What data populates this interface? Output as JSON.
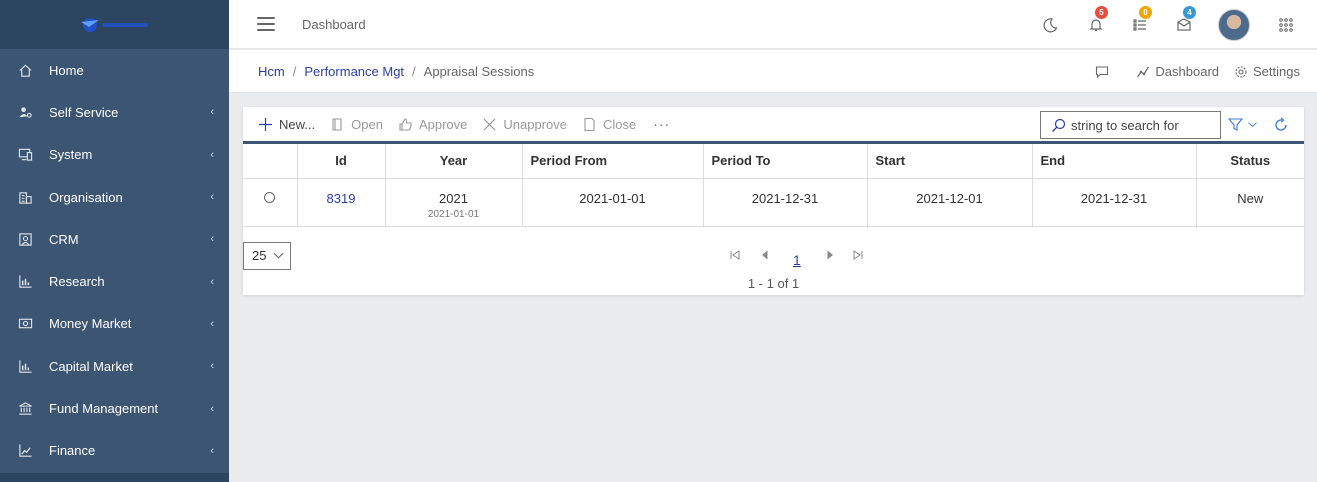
{
  "colors": {
    "sidebar": "#3b5573",
    "accent": "#2a40a8",
    "badge_red": "#e74c3c",
    "badge_orange": "#f0a500",
    "badge_blue": "#3498db"
  },
  "sidebar": {
    "logo_icon": "company-logo",
    "items": [
      {
        "label": "Home",
        "icon": "home-icon",
        "has_submenu": false
      },
      {
        "label": "Self Service",
        "icon": "user-settings-icon",
        "has_submenu": true
      },
      {
        "label": "System",
        "icon": "monitor-icon",
        "has_submenu": true
      },
      {
        "label": "Organisation",
        "icon": "building-icon",
        "has_submenu": true
      },
      {
        "label": "CRM",
        "icon": "crm-icon",
        "has_submenu": true
      },
      {
        "label": "Research",
        "icon": "bar-chart-icon",
        "has_submenu": true
      },
      {
        "label": "Money Market",
        "icon": "money-icon",
        "has_submenu": true
      },
      {
        "label": "Capital Market",
        "icon": "bar-chart-icon",
        "has_submenu": true
      },
      {
        "label": "Fund Management",
        "icon": "bank-icon",
        "has_submenu": true
      },
      {
        "label": "Finance",
        "icon": "finance-icon",
        "has_submenu": true
      }
    ]
  },
  "topbar": {
    "title": "Dashboard",
    "notifications_count": "5",
    "tasks_count": "0",
    "messages_count": "4"
  },
  "breadcrumb": {
    "items": [
      "Hcm",
      "Performance Mgt"
    ],
    "current": "Appraisal Sessions",
    "actions": {
      "dashboard": "Dashboard",
      "settings": "Settings"
    }
  },
  "toolbar": {
    "new": "New...",
    "open": "Open",
    "approve": "Approve",
    "unapprove": "Unapprove",
    "close": "Close",
    "more": "···",
    "search_placeholder": "string to search for"
  },
  "table": {
    "headers": [
      "Id",
      "Year",
      "Period From",
      "Period To",
      "Start",
      "End",
      "Status"
    ],
    "rows": [
      {
        "id": "8319",
        "year": "2021",
        "year_sub": "2021-01-01",
        "period_from": "2021-01-01",
        "period_to": "2021-12-31",
        "start": "2021-12-01",
        "end": "2021-12-31",
        "status": "New"
      }
    ]
  },
  "pager": {
    "page_size": "25",
    "current_page": "1",
    "info": "1 - 1 of 1"
  }
}
